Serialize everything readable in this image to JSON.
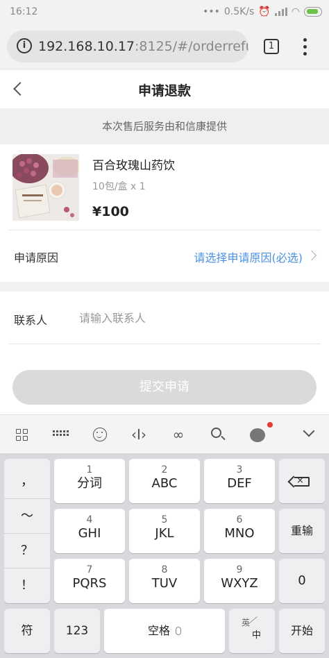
{
  "status_bar": {
    "time": "16:12",
    "dots": "•••",
    "speed": "0.5K/s"
  },
  "browser": {
    "url_main": "192.168.10.17",
    "url_rest": ":8125/#/orderrefund",
    "tab_count": "1"
  },
  "header": {
    "title": "申请退款"
  },
  "service_note": "本次售后服务由和信康提供",
  "product": {
    "name": "百合玫瑰山药饮",
    "spec": "10包/盒 x 1",
    "price": "¥100"
  },
  "reason": {
    "label": "申请原因",
    "value": "请选择申请原因(必选)"
  },
  "contact": {
    "label": "联系人",
    "placeholder": "请输入联系人"
  },
  "submit_label": "提交申请",
  "keyboard": {
    "toolbar_icons": [
      "grid-icon",
      "keyboard-icon",
      "emoji-icon",
      "cursor-icon",
      "link-icon",
      "search-icon",
      "brand-icon",
      "collapse-icon"
    ],
    "side_keys": [
      "，",
      "～",
      "？",
      "！"
    ],
    "keys": [
      {
        "num": "1",
        "letters": "分词"
      },
      {
        "num": "2",
        "letters": "ABC"
      },
      {
        "num": "3",
        "letters": "DEF"
      },
      {
        "num": "4",
        "letters": "GHI"
      },
      {
        "num": "5",
        "letters": "JKL"
      },
      {
        "num": "6",
        "letters": "MNO"
      },
      {
        "num": "7",
        "letters": "PQRS"
      },
      {
        "num": "8",
        "letters": "TUV"
      },
      {
        "num": "9",
        "letters": "WXYZ"
      }
    ],
    "redo": "重输",
    "zero": "0",
    "symbols": "符",
    "num_switch": "123",
    "space": "空格",
    "lang_en": "英",
    "lang_zh": "中",
    "enter": "开始"
  }
}
